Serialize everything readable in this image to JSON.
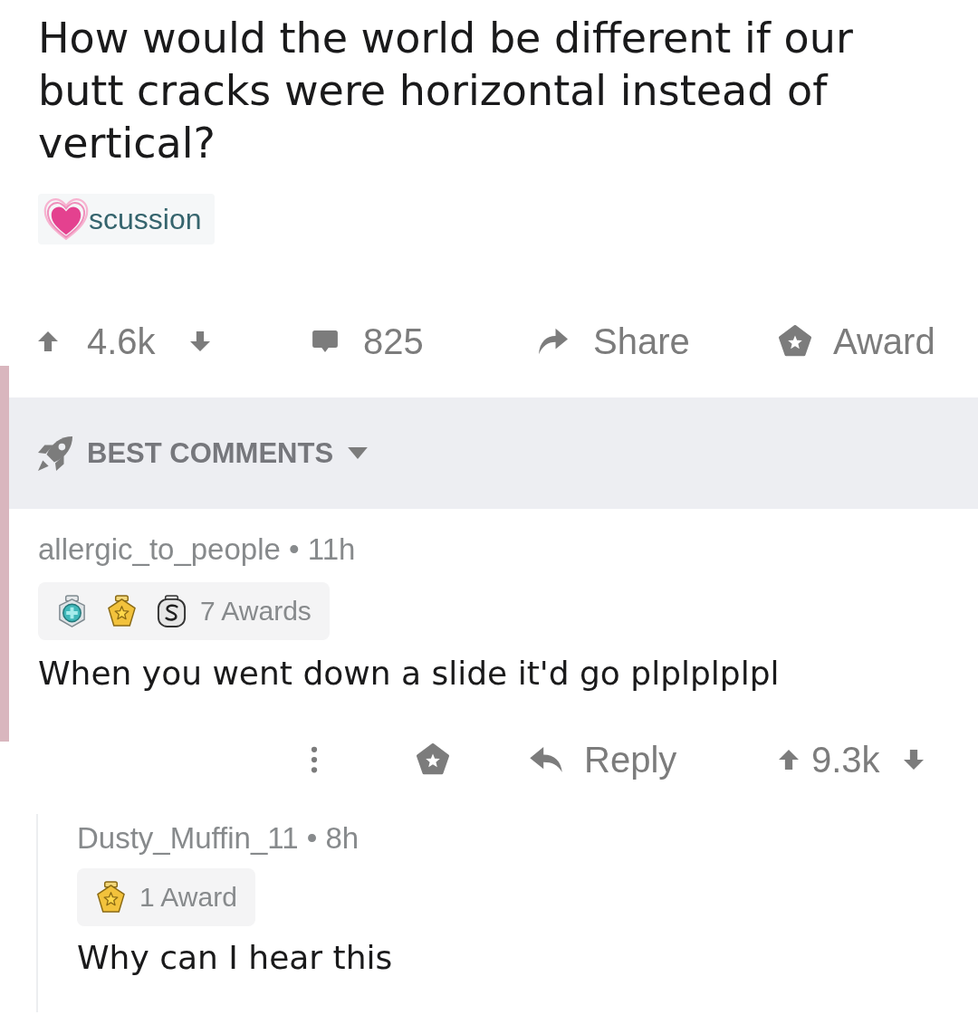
{
  "post": {
    "title": "How would the world be different if our butt cracks were horizontal instead of vertical?",
    "flair": {
      "text": "scussion"
    },
    "score": "4.6k",
    "comment_count": "825",
    "share_label": "Share",
    "award_label": "Award"
  },
  "sort": {
    "label": "BEST COMMENTS"
  },
  "comments": [
    {
      "byline": "allergic_to_people • 11h",
      "highlighted": true,
      "awards": [
        {
          "kind": "plus"
        },
        {
          "kind": "star"
        },
        {
          "kind": "coin"
        }
      ],
      "awards_label": "7 Awards",
      "text": "When you went down a slide it'd go plplplplpl",
      "reply_label": "Reply",
      "score": "9.3k",
      "replies": [
        {
          "byline": "Dusty_Muffin_11 • 8h",
          "awards": [
            {
              "kind": "star"
            }
          ],
          "awards_label": "1 Award",
          "text": "Why can I hear this"
        }
      ]
    }
  ]
}
